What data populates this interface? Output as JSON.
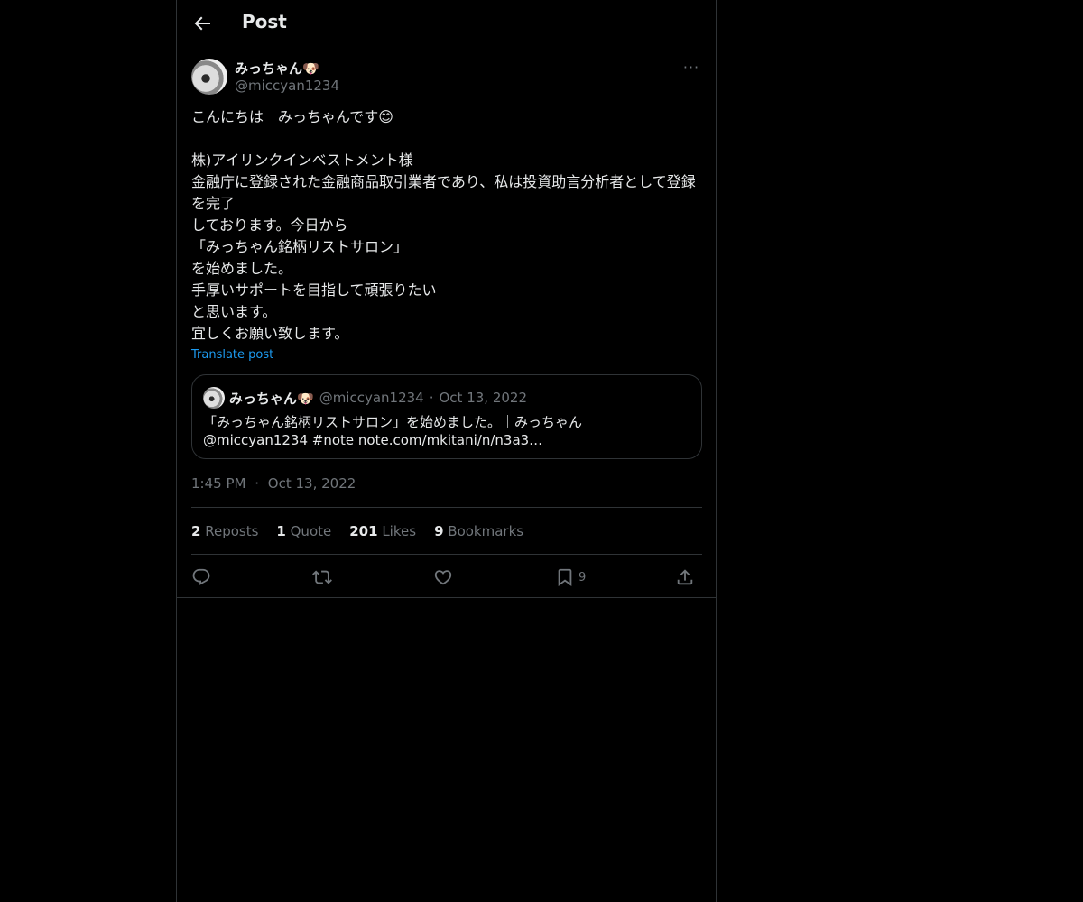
{
  "header": {
    "title": "Post",
    "back_icon": "arrow-left-icon"
  },
  "author": {
    "display_name": "みっちゃん🐶",
    "handle": "@miccyan1234",
    "more_icon": "more-horizontal-icon",
    "more_glyph": "···"
  },
  "post": {
    "text": "こんにちは　みっちゃんです😊\n\n株)アイリンクインベストメント様\n金融庁に登録された金融商品取引業者であり、私は投資助言分析者として登録を完了\nしております。今日から\n「みっちゃん銘柄リストサロン」\nを始めました。\n手厚いサポートを目指して頑張りたい\nと思います。\n宜しくお願い致します。",
    "translate_label": "Translate post"
  },
  "quote": {
    "display_name": "みっちゃん🐶",
    "handle": "@miccyan1234",
    "separator": "·",
    "date": "Oct 13, 2022",
    "text": "「みっちゃん銘柄リストサロン」を始めました。｜みっちゃん @miccyan1234 #note note.com/mkitani/n/n3a3…"
  },
  "timestamp": {
    "time": "1:45 PM",
    "separator": "·",
    "date": "Oct 13, 2022"
  },
  "stats": {
    "reposts": {
      "count": "2",
      "label": "Reposts"
    },
    "quotes": {
      "count": "1",
      "label": "Quote"
    },
    "likes": {
      "count": "201",
      "label": "Likes"
    },
    "bookmarks": {
      "count": "9",
      "label": "Bookmarks"
    }
  },
  "actions": {
    "reply_icon": "reply-icon",
    "repost_icon": "repost-icon",
    "like_icon": "heart-icon",
    "bookmark_icon": "bookmark-icon",
    "bookmark_count": "9",
    "share_icon": "share-icon"
  },
  "colors": {
    "background": "#000000",
    "text": "#e7e9ea",
    "muted": "#71767b",
    "accent": "#1d9bf0",
    "border": "#2f3336"
  }
}
